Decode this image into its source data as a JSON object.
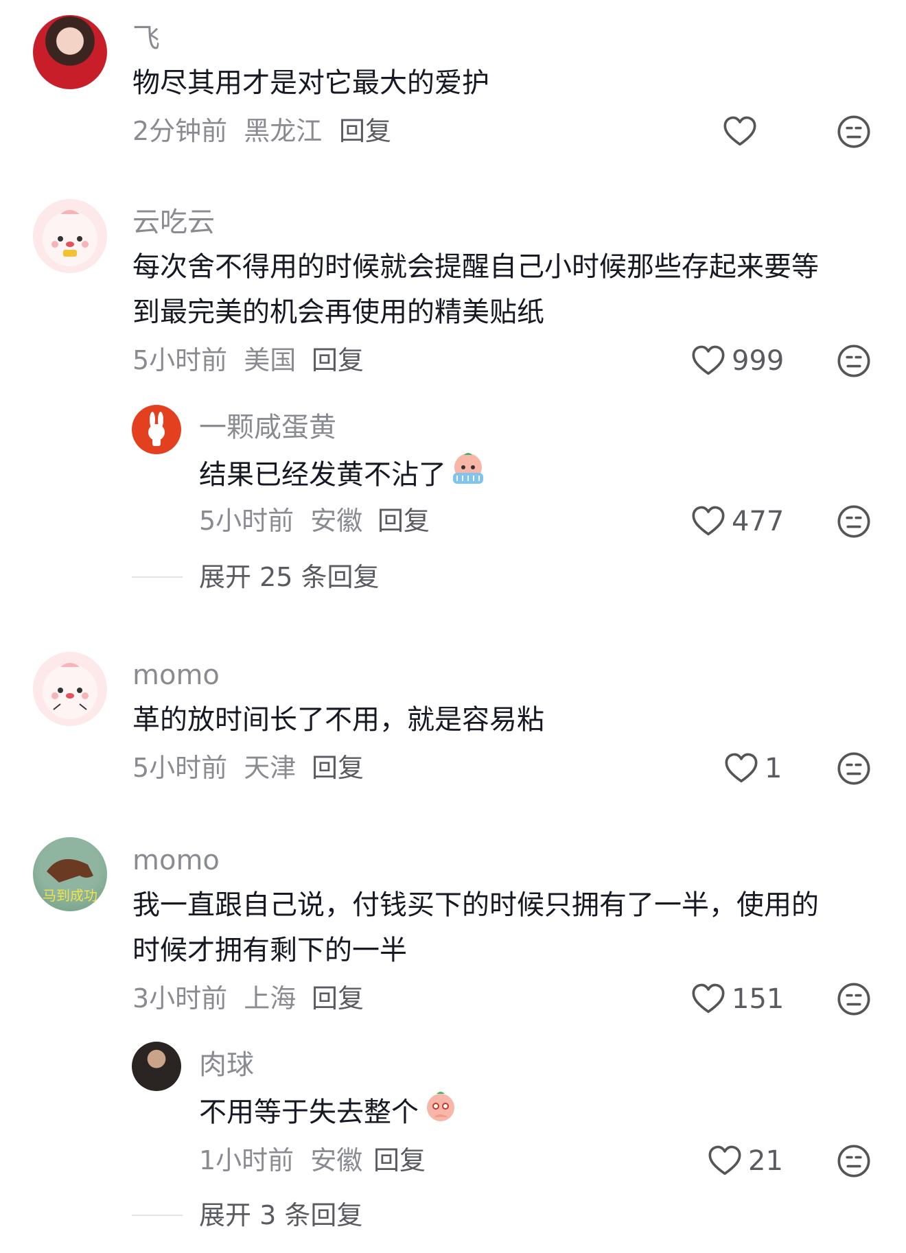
{
  "comments": [
    {
      "username": "飞",
      "text": "物尽其用才是对它最大的爱护",
      "time": "2分钟前",
      "location": "黑龙江",
      "reply_label": "回复",
      "like_count": ""
    },
    {
      "username": "云吃云",
      "text_lines": [
        "每次舍不得用的时候就会提醒自己小时候那些存起来要等",
        "到最完美的机会再使用的精美贴纸"
      ],
      "time": "5小时前",
      "location": "美国",
      "reply_label": "回复",
      "like_count": "999",
      "sub_reply": {
        "username": "一颗咸蛋黄",
        "text": "结果已经发黄不沾了",
        "emoji": "crying-face",
        "time": "5小时前",
        "location": "安徽",
        "reply_label": "回复",
        "like_count": "477"
      },
      "expand_label": "展开 25 条回复"
    },
    {
      "username": "momo",
      "text": "革的放时间长了不用，就是容易粘",
      "time": "5小时前",
      "location": "天津",
      "reply_label": "回复",
      "like_count": "1"
    },
    {
      "username": "momo",
      "avatar_caption": "马到成功",
      "text_lines": [
        "我一直跟自己说，付钱买下的时候只拥有了一半，使用的",
        "时候才拥有剩下的一半"
      ],
      "time": "3小时前",
      "location": "上海",
      "reply_label": "回复",
      "like_count": "151",
      "sub_reply": {
        "username": "肉球",
        "text": "不用等于失去整个",
        "emoji": "shy-face",
        "time": "1小时前",
        "location": "安徽",
        "reply_label": "回复",
        "like_count": "21"
      },
      "expand_label": "展开 3 条回复"
    }
  ],
  "colors": {
    "muted": "#8a8b91",
    "text": "#161823",
    "action": "#5a5b61"
  }
}
